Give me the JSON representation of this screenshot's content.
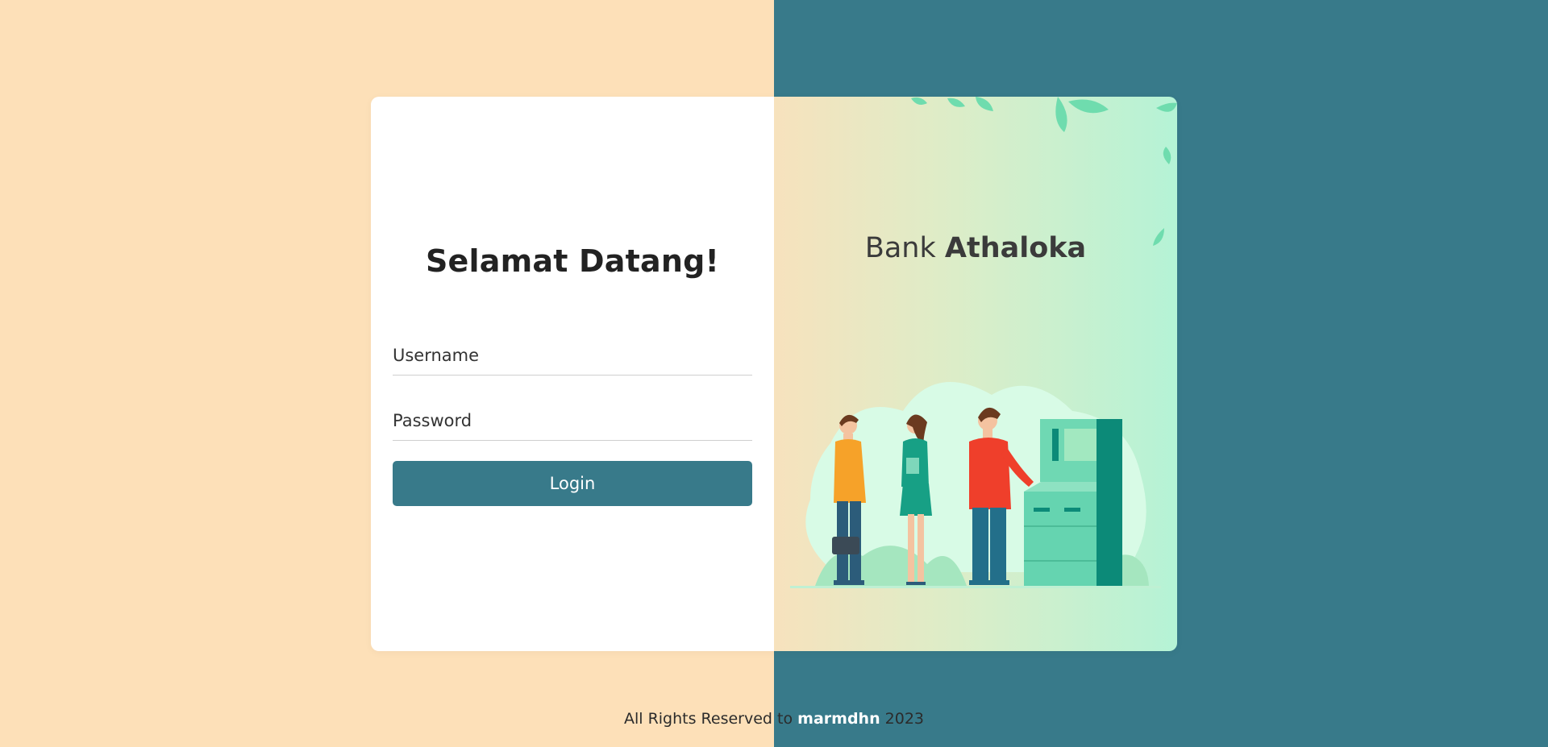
{
  "login": {
    "title": "Selamat Datang!",
    "username_placeholder": "Username",
    "password_placeholder": "Password",
    "button_label": "Login"
  },
  "brand": {
    "prefix": "Bank",
    "name": "Athaloka"
  },
  "footer": {
    "prefix": "All Rights Reserved to",
    "owner": "marmdhn",
    "year": "2023"
  },
  "colors": {
    "left_background": "#fde0b8",
    "right_background": "#387a8a",
    "accent": "#387a8a",
    "card": "#ffffff"
  },
  "illustration": {
    "icon": "atm-queue-illustration"
  }
}
